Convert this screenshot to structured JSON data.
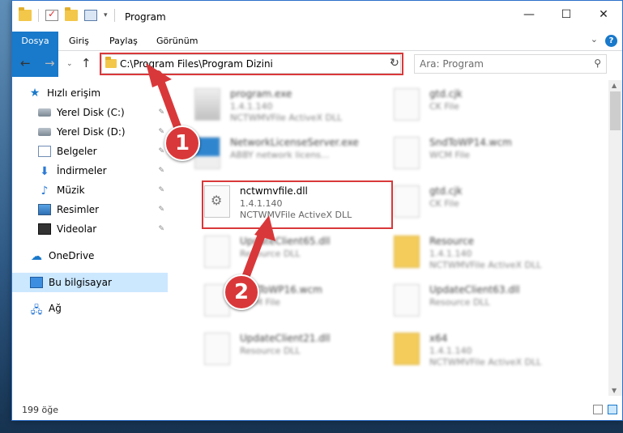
{
  "window": {
    "title": "Program",
    "minimize_glyph": "—",
    "maximize_glyph": "☐",
    "close_glyph": "✕"
  },
  "ribbon": {
    "tabs": [
      {
        "label": "Dosya"
      },
      {
        "label": "Giriş"
      },
      {
        "label": "Paylaş"
      },
      {
        "label": "Görünüm"
      }
    ],
    "help_glyph": "?",
    "expand_glyph": "⌄"
  },
  "navigation": {
    "back_glyph": "←",
    "forward_glyph": "→",
    "recent_glyph": "⌄",
    "up_glyph": "↑",
    "address_path": "C:\\Program Files\\Program Dizini",
    "dropdown_glyph": "⌄",
    "refresh_glyph": "↻",
    "search_placeholder": "Ara: Program",
    "search_glyph": "⚲"
  },
  "sidebar": {
    "items": [
      {
        "label": "Hızlı erişim",
        "icon": "star-icon"
      },
      {
        "label": "Yerel Disk (C:)",
        "icon": "disk-icon",
        "pinned": true
      },
      {
        "label": "Yerel Disk (D:)",
        "icon": "disk-icon",
        "pinned": true
      },
      {
        "label": "Belgeler",
        "icon": "document-icon",
        "pinned": true
      },
      {
        "label": "İndirmeler",
        "icon": "download-icon",
        "pinned": true
      },
      {
        "label": "Müzik",
        "icon": "music-icon",
        "pinned": true
      },
      {
        "label": "Resimler",
        "icon": "pictures-icon",
        "pinned": true
      },
      {
        "label": "Videolar",
        "icon": "video-icon",
        "pinned": true
      },
      {
        "label": "OneDrive",
        "icon": "cloud-icon"
      },
      {
        "label": "Bu bilgisayar",
        "icon": "computer-icon",
        "selected": true
      },
      {
        "label": "Ağ",
        "icon": "network-icon"
      }
    ],
    "pin_glyph": "📌"
  },
  "files": [
    {
      "name": "program.exe",
      "line2": "1.4.1.140",
      "line3": "NCTWMVFile ActiveX DLL",
      "kind": "exe"
    },
    {
      "name": "gtd.cjk",
      "line2": "CK File",
      "line3": "",
      "kind": "file"
    },
    {
      "name": "NetworkLicenseServer.exe",
      "line2": "ABBY network licens...",
      "line3": "",
      "kind": "exe2"
    },
    {
      "name": "SndToWP14.wcm",
      "line2": "WCM File",
      "line3": "",
      "kind": "file"
    },
    {
      "name": "nctwmvfile.dll",
      "line2": "1.4.1.140",
      "line3": "NCTWMVFile ActiveX DLL",
      "kind": "dll"
    },
    {
      "name": "gtd.cjk",
      "line2": "CK File",
      "line3": "",
      "kind": "file"
    },
    {
      "name": "UpdateClient65.dll",
      "line2": "Resource DLL",
      "line3": "",
      "kind": "file"
    },
    {
      "name": "Resource",
      "line2": "1.4.1.140",
      "line3": "NCTWMVFile ActiveX DLL",
      "kind": "folder"
    },
    {
      "name": "SndToWP16.wcm",
      "line2": "WCM File",
      "line3": "",
      "kind": "file"
    },
    {
      "name": "UpdateClient63.dll",
      "line2": "Resource DLL",
      "line3": "",
      "kind": "file"
    },
    {
      "name": "UpdateClient21.dll",
      "line2": "Resource DLL",
      "line3": "",
      "kind": "file"
    },
    {
      "name": "x64",
      "line2": "1.4.1.140",
      "line3": "NCTWMVFile ActiveX DLL",
      "kind": "folder"
    }
  ],
  "status": {
    "item_count": "199 öğe"
  },
  "callouts": [
    {
      "number": "1"
    },
    {
      "number": "2"
    }
  ],
  "colors": {
    "accent": "#1979ca",
    "highlight": "#d9383a",
    "selected_bg": "#cce8ff"
  }
}
